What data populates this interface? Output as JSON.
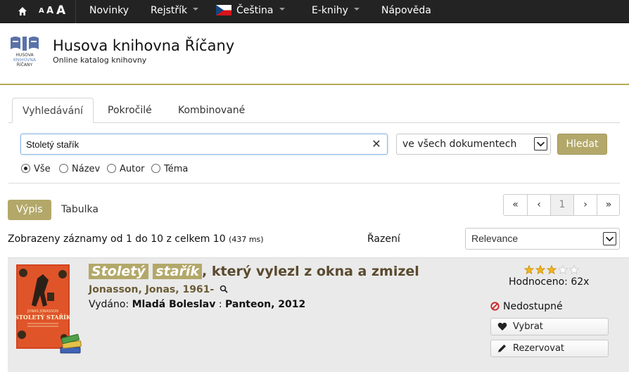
{
  "topbar": {
    "font_sizes": [
      "A",
      "A",
      "A"
    ],
    "nav": [
      {
        "label": "Novinky",
        "dropdown": false
      },
      {
        "label": "Rejstřík",
        "dropdown": true
      },
      {
        "label": "Čeština",
        "dropdown": true
      },
      {
        "label": "E-knihy",
        "dropdown": true
      },
      {
        "label": "Nápověda",
        "dropdown": false
      }
    ]
  },
  "header": {
    "title": "Husova knihovna Říčany",
    "subtitle": "Online katalog knihovny",
    "logo_text": "HUSOVA KNIHOVNA ŘÍČANY"
  },
  "tabs": [
    {
      "label": "Vyhledávání",
      "active": true
    },
    {
      "label": "Pokročilé",
      "active": false
    },
    {
      "label": "Kombinované",
      "active": false
    }
  ],
  "search": {
    "value": "Stoletý stařík",
    "scope": "ve všech dokumentech",
    "button": "Hledat",
    "radios": [
      {
        "label": "Vše",
        "checked": true
      },
      {
        "label": "Název",
        "checked": false
      },
      {
        "label": "Autor",
        "checked": false
      },
      {
        "label": "Téma",
        "checked": false
      }
    ]
  },
  "view": {
    "modes": [
      "Výpis",
      "Tabulka"
    ],
    "active": "Výpis"
  },
  "pager": [
    "«",
    "‹",
    "1",
    "›",
    "»"
  ],
  "results": {
    "summary": "Zobrazeny záznamy od 1 do 10 z celkem 10",
    "time": "(437 ms)",
    "sort_label": "Řazení",
    "sort_value": "Relevance"
  },
  "record": {
    "title_hl_1": "Stoletý",
    "title_hl_2": "stařík",
    "title_rest": ", který vylezl z okna a zmizel",
    "author": "Jonasson, Jonas, 1961-",
    "published_label": "Vydáno:",
    "published_place": "Mladá Boleslav",
    "published_sep": " : ",
    "published_publisher": "Panteon, 2012",
    "rating_stars": 3,
    "rating_max": 5,
    "rating_text": "Hodnoceno: 62x",
    "availability": "Nedostupné",
    "btn_select": "Vybrat",
    "btn_reserve": "Rezervovat",
    "cover_author": "JONAS JONASSON",
    "cover_title": "STOLETÝ STAŘÍK"
  },
  "colors": {
    "accent": "#b3a86a",
    "topbar": "#232323",
    "title_brown": "#5a4a2e",
    "unavailable_red": "#cc2222"
  },
  "icons": [
    "home-icon",
    "flag-cz-icon",
    "clear-icon",
    "chevron-down-icon",
    "search-icon",
    "heart-icon",
    "pencil-icon",
    "no-entry-icon",
    "star-icon",
    "book-stack-icon"
  ]
}
